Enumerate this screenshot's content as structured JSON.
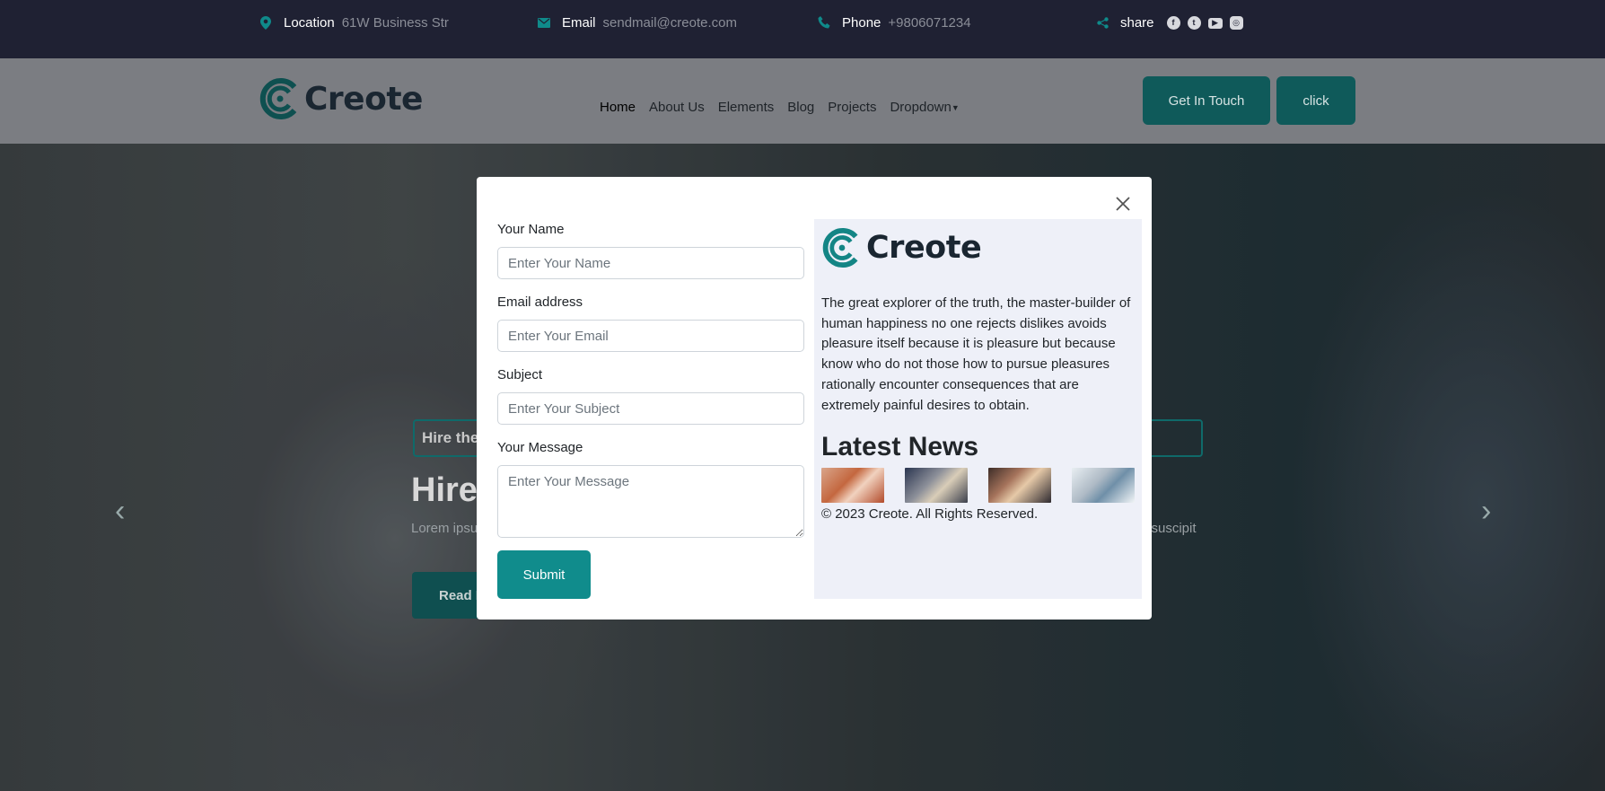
{
  "topbar": {
    "location_label": "Location",
    "location_value": "61W Business Str",
    "email_label": "Email",
    "email_value": "sendmail@creote.com",
    "phone_label": "Phone",
    "phone_value": "+9806071234",
    "share_label": "share",
    "social_icons": [
      "facebook-icon",
      "twitter-icon",
      "youtube-icon",
      "instagram-icon"
    ]
  },
  "brand": {
    "name": "Creote",
    "accent_color": "#108c8c"
  },
  "nav": {
    "items": [
      "Home",
      "About Us",
      "Elements",
      "Blog",
      "Projects",
      "Dropdown"
    ]
  },
  "header_buttons": {
    "get_in_touch": "Get In Touch",
    "click": "click"
  },
  "hero": {
    "tag": "Hire the",
    "title": "Hire",
    "subtitle_left": "Lorem ipsu",
    "subtitle_right": "n suscipit",
    "button": "Read M"
  },
  "modal": {
    "form": {
      "name_label": "Your Name",
      "name_placeholder": "Enter Your Name",
      "email_label": "Email address",
      "email_placeholder": "Enter Your Email",
      "subject_label": "Subject",
      "subject_placeholder": "Enter Your Subject",
      "message_label": "Your Message",
      "message_placeholder": "Enter Your Message",
      "submit": "Submit"
    },
    "side": {
      "description": "The great explorer of the truth, the master-builder of human happiness no one rejects dislikes avoids pleasure itself because it is pleasure but because know who do not those how to pursue pleasures rationally encounter consequences that are extremely painful desires to obtain.",
      "news_heading": "Latest News",
      "copyright": "© 2023 Creote. All Rights Reserved."
    }
  }
}
